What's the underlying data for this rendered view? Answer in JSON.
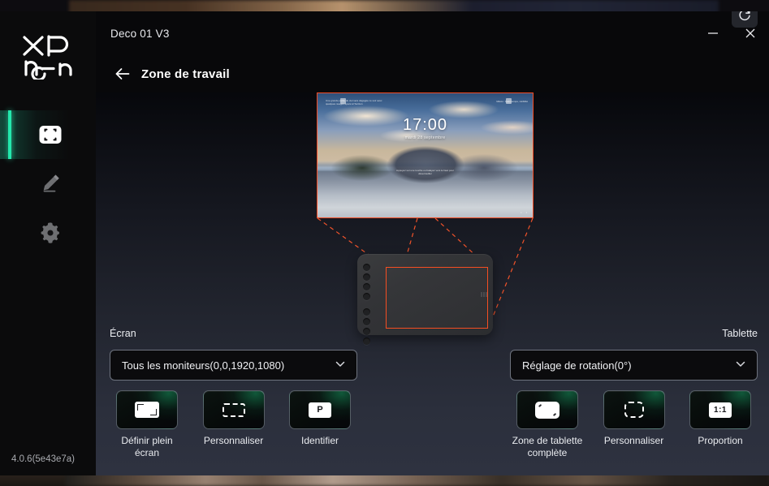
{
  "window": {
    "title": "Deco 01 V3",
    "minimize_label": "—",
    "close_label": "✕"
  },
  "sidebar": {
    "logo_line1": "XP",
    "logo_line2": "pen",
    "version": "4.0.6(5e43e7a)",
    "items": [
      {
        "name": "work-area",
        "icon": "work-area-icon",
        "active": true
      },
      {
        "name": "pen",
        "icon": "pen-icon",
        "active": false
      },
      {
        "name": "settings",
        "icon": "gear-icon",
        "active": false
      }
    ]
  },
  "page": {
    "title": "Zone de travail",
    "back_icon": "back-arrow-icon",
    "refresh_icon": "refresh-icon"
  },
  "preview": {
    "monitor": {
      "clock": "17:00",
      "date": "mardi 28 septembre",
      "widget_left": "Une grande partie du ciel sera dégagée ce soir avec quelques nuages épars à l'horizon",
      "widget_right": "Météo : beau temps, visibilité",
      "widget_mid": "Appuyez sur une touche ou balayez vers le haut pour déverrouiller",
      "taskbar": "• •"
    },
    "tablet": {
      "key_count": 8,
      "active_area_color": "#f54e22"
    },
    "mapping_line_color": "#f24b24"
  },
  "screen_panel": {
    "label": "Écran",
    "dropdown_value": "Tous les moniteurs(0,0,1920,1080)",
    "dropdown_chevron": "chevron-down-icon",
    "buttons": [
      {
        "label": "Définir plein écran",
        "icon": "fullscreen-icon"
      },
      {
        "label": "Personnaliser",
        "icon": "customize-dashed-icon"
      },
      {
        "label": "Identifier",
        "icon": "identify-p-icon",
        "glyph": "P"
      }
    ]
  },
  "tablet_panel": {
    "label": "Tablette",
    "dropdown_value": "Réglage de rotation(0°)",
    "dropdown_chevron": "chevron-down-icon",
    "buttons": [
      {
        "label": "Zone de tablette complète",
        "icon": "full-tablet-area-icon"
      },
      {
        "label": "Personnaliser",
        "icon": "customize-dashed-icon"
      },
      {
        "label": "Proportion",
        "icon": "ratio-icon",
        "glyph": "1:1"
      }
    ]
  },
  "colors": {
    "accent_green": "#23e8ad",
    "mapping_orange": "#f24b24",
    "panel_dark": "#08080a"
  }
}
